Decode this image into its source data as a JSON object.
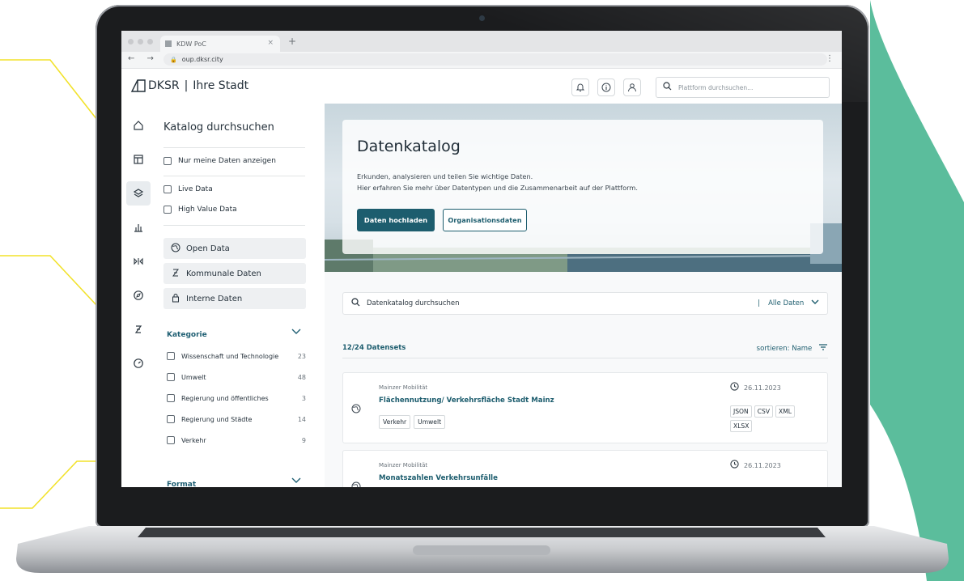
{
  "colors": {
    "accent": "#1d5d6e",
    "green_shape": "#5bbd9c",
    "yellow_lines": "#f2e22a"
  },
  "browser": {
    "tab_title": "KDW PoC",
    "tab_close": "×",
    "new_tab": "+",
    "nav": "← → C",
    "url": "oup.dksr.city",
    "menu": "⋮"
  },
  "header": {
    "logo_text": "DKSR",
    "logo_separator": "|",
    "logo_sub": "Ihre Stadt",
    "search_placeholder": "Plattform durchsuchen...",
    "icons": [
      "bell-icon",
      "info-icon",
      "user-icon"
    ]
  },
  "rail": {
    "items": [
      "home-icon",
      "dashboard-icon",
      "layers-icon",
      "chart-icon",
      "transform-icon",
      "compass-icon",
      "z-icon",
      "gauge-icon"
    ]
  },
  "filters": {
    "title": "Katalog durchsuchen",
    "my_data": "Nur meine Daten anzeigen",
    "live_data": "Live Data",
    "high_value": "High Value Data",
    "types": [
      {
        "label": "Open Data",
        "icon": "globe-icon"
      },
      {
        "label": "Kommunale Daten",
        "icon": "z-icon"
      },
      {
        "label": "Interne Daten",
        "icon": "lock-icon"
      }
    ],
    "category_title": "Kategorie",
    "categories": [
      {
        "label": "Wissenschaft und Technologie",
        "count": "23"
      },
      {
        "label": "Umwelt",
        "count": "48"
      },
      {
        "label": "Regierung und öffentliches",
        "count": "3"
      },
      {
        "label": "Regierung und Städte",
        "count": "14"
      },
      {
        "label": "Verkehr",
        "count": "9"
      }
    ],
    "format_title": "Format"
  },
  "hero": {
    "title": "Datenkatalog",
    "text1": "Erkunden, analysieren und teilen Sie wichtige Daten.",
    "text2": "Hier erfahren Sie mehr über Datentypen und die Zusammenarbeit auf der Plattform.",
    "btn_upload": "Daten hochladen",
    "btn_org": "Organisationsdaten"
  },
  "catalog": {
    "search_placeholder": "Datenkatalog durchsuchen",
    "scope": "Alle Daten",
    "count": "12/24 Datensets",
    "sort": "sortieren: Name"
  },
  "datasets": [
    {
      "owner": "Mainzer Mobilität",
      "title": "Flächennutzung/ Verkehrsfläche Stadt Mainz",
      "tags": [
        "Verkehr",
        "Umwelt"
      ],
      "date": "26.11.2023",
      "formats": [
        "JSON",
        "CSV",
        "XML",
        "XLSX"
      ]
    },
    {
      "owner": "Mainzer Mobilität",
      "title": "Monatszahlen Verkehrsunfälle",
      "tags": [],
      "date": "26.11.2023",
      "formats": []
    }
  ]
}
